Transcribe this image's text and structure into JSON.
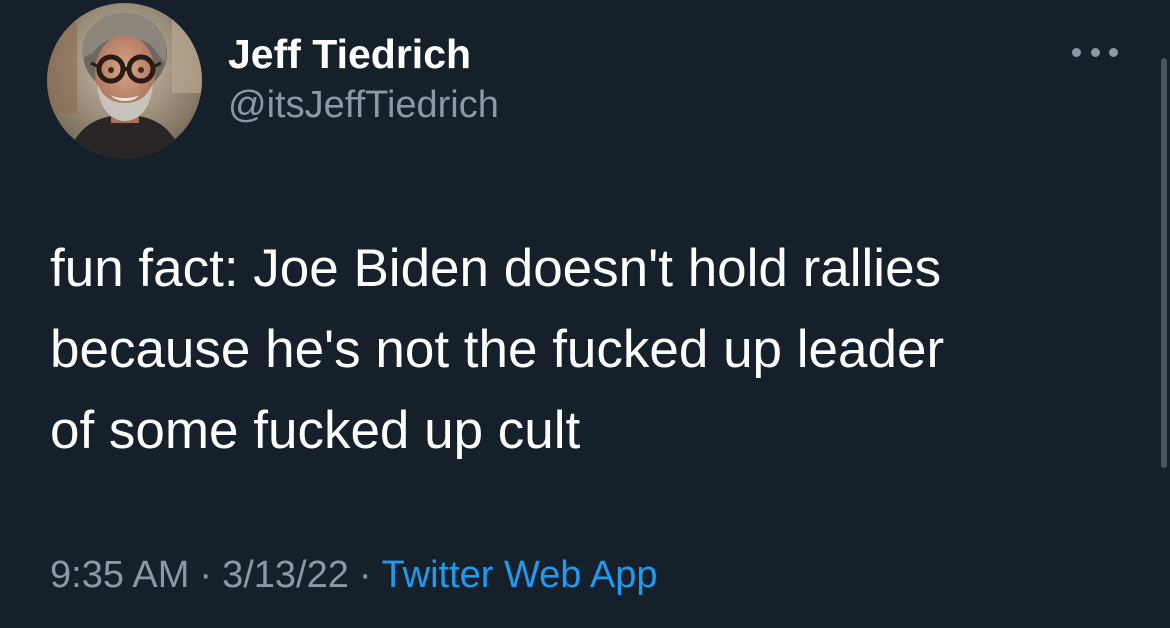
{
  "author": {
    "display_name": "Jeff Tiedrich",
    "handle": "@itsJeffTiedrich",
    "avatar_icon": "profile-photo"
  },
  "tweet": {
    "text_lines": [
      "fun fact: Joe Biden doesn't hold rallies",
      "because he's not the fucked up leader",
      "of some fucked up cult"
    ],
    "time": "9:35 AM",
    "date": "3/13/22",
    "source": "Twitter Web App",
    "separator": "·"
  },
  "more_button_icon": "more-horizontal-icon",
  "colors": {
    "background": "#15202b",
    "primary_text": "#ffffff",
    "secondary_text": "#8b98a5",
    "link": "#1d9bf0"
  }
}
